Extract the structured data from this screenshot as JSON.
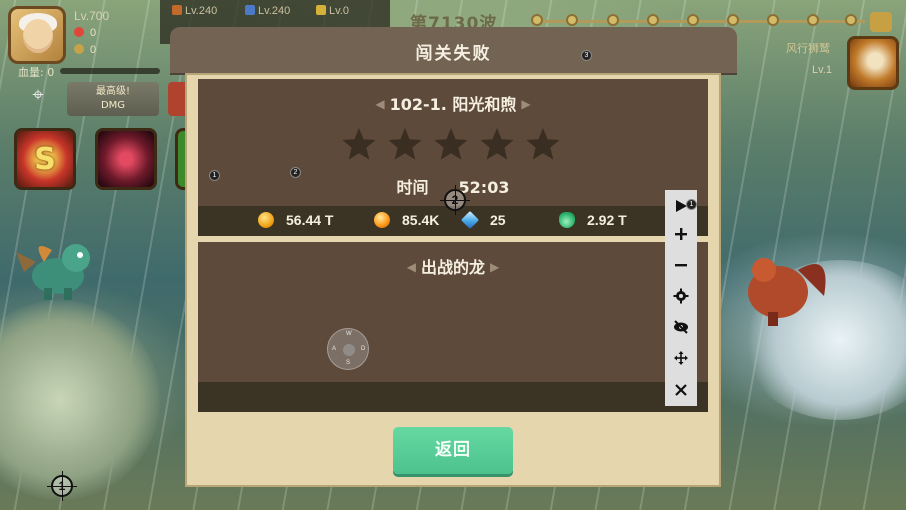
{
  "hud": {
    "player_level": "Lv.700",
    "hearts": "0",
    "swords": "0",
    "hp_label": "血量: 0",
    "dmg_button_top": "最高级!",
    "dmg_button_bottom": "DMG",
    "top_levels": [
      "Lv.240",
      "Lv.240",
      "Lv.0"
    ],
    "wave_text": "第7130波",
    "boss_name": "风行狮鹫",
    "boss_level": "Lv.1",
    "skill_glyph": "S"
  },
  "dialog": {
    "title": "闯关失败",
    "stage_name": "102-1. 阳光和煦",
    "stars": [
      false,
      false,
      false,
      false,
      false
    ],
    "time_label": "时间",
    "time_value": "52:03",
    "rewards": [
      {
        "icon": "coin-icon",
        "value": "56.44 T"
      },
      {
        "icon": "orb-icon",
        "value": "85.4K"
      },
      {
        "icon": "gem-icon",
        "value": "25"
      },
      {
        "icon": "potion-icon",
        "value": "2.92 T"
      }
    ],
    "dragons_title": "出战的龙",
    "return_button": "返回"
  },
  "overlay": {
    "joystick_dirs": {
      "n": "W",
      "w": "A",
      "e": "D",
      "s": "S"
    },
    "markers": [
      "1",
      "2",
      "3",
      "1"
    ],
    "crosshair_labels": [
      "2",
      "1"
    ]
  }
}
